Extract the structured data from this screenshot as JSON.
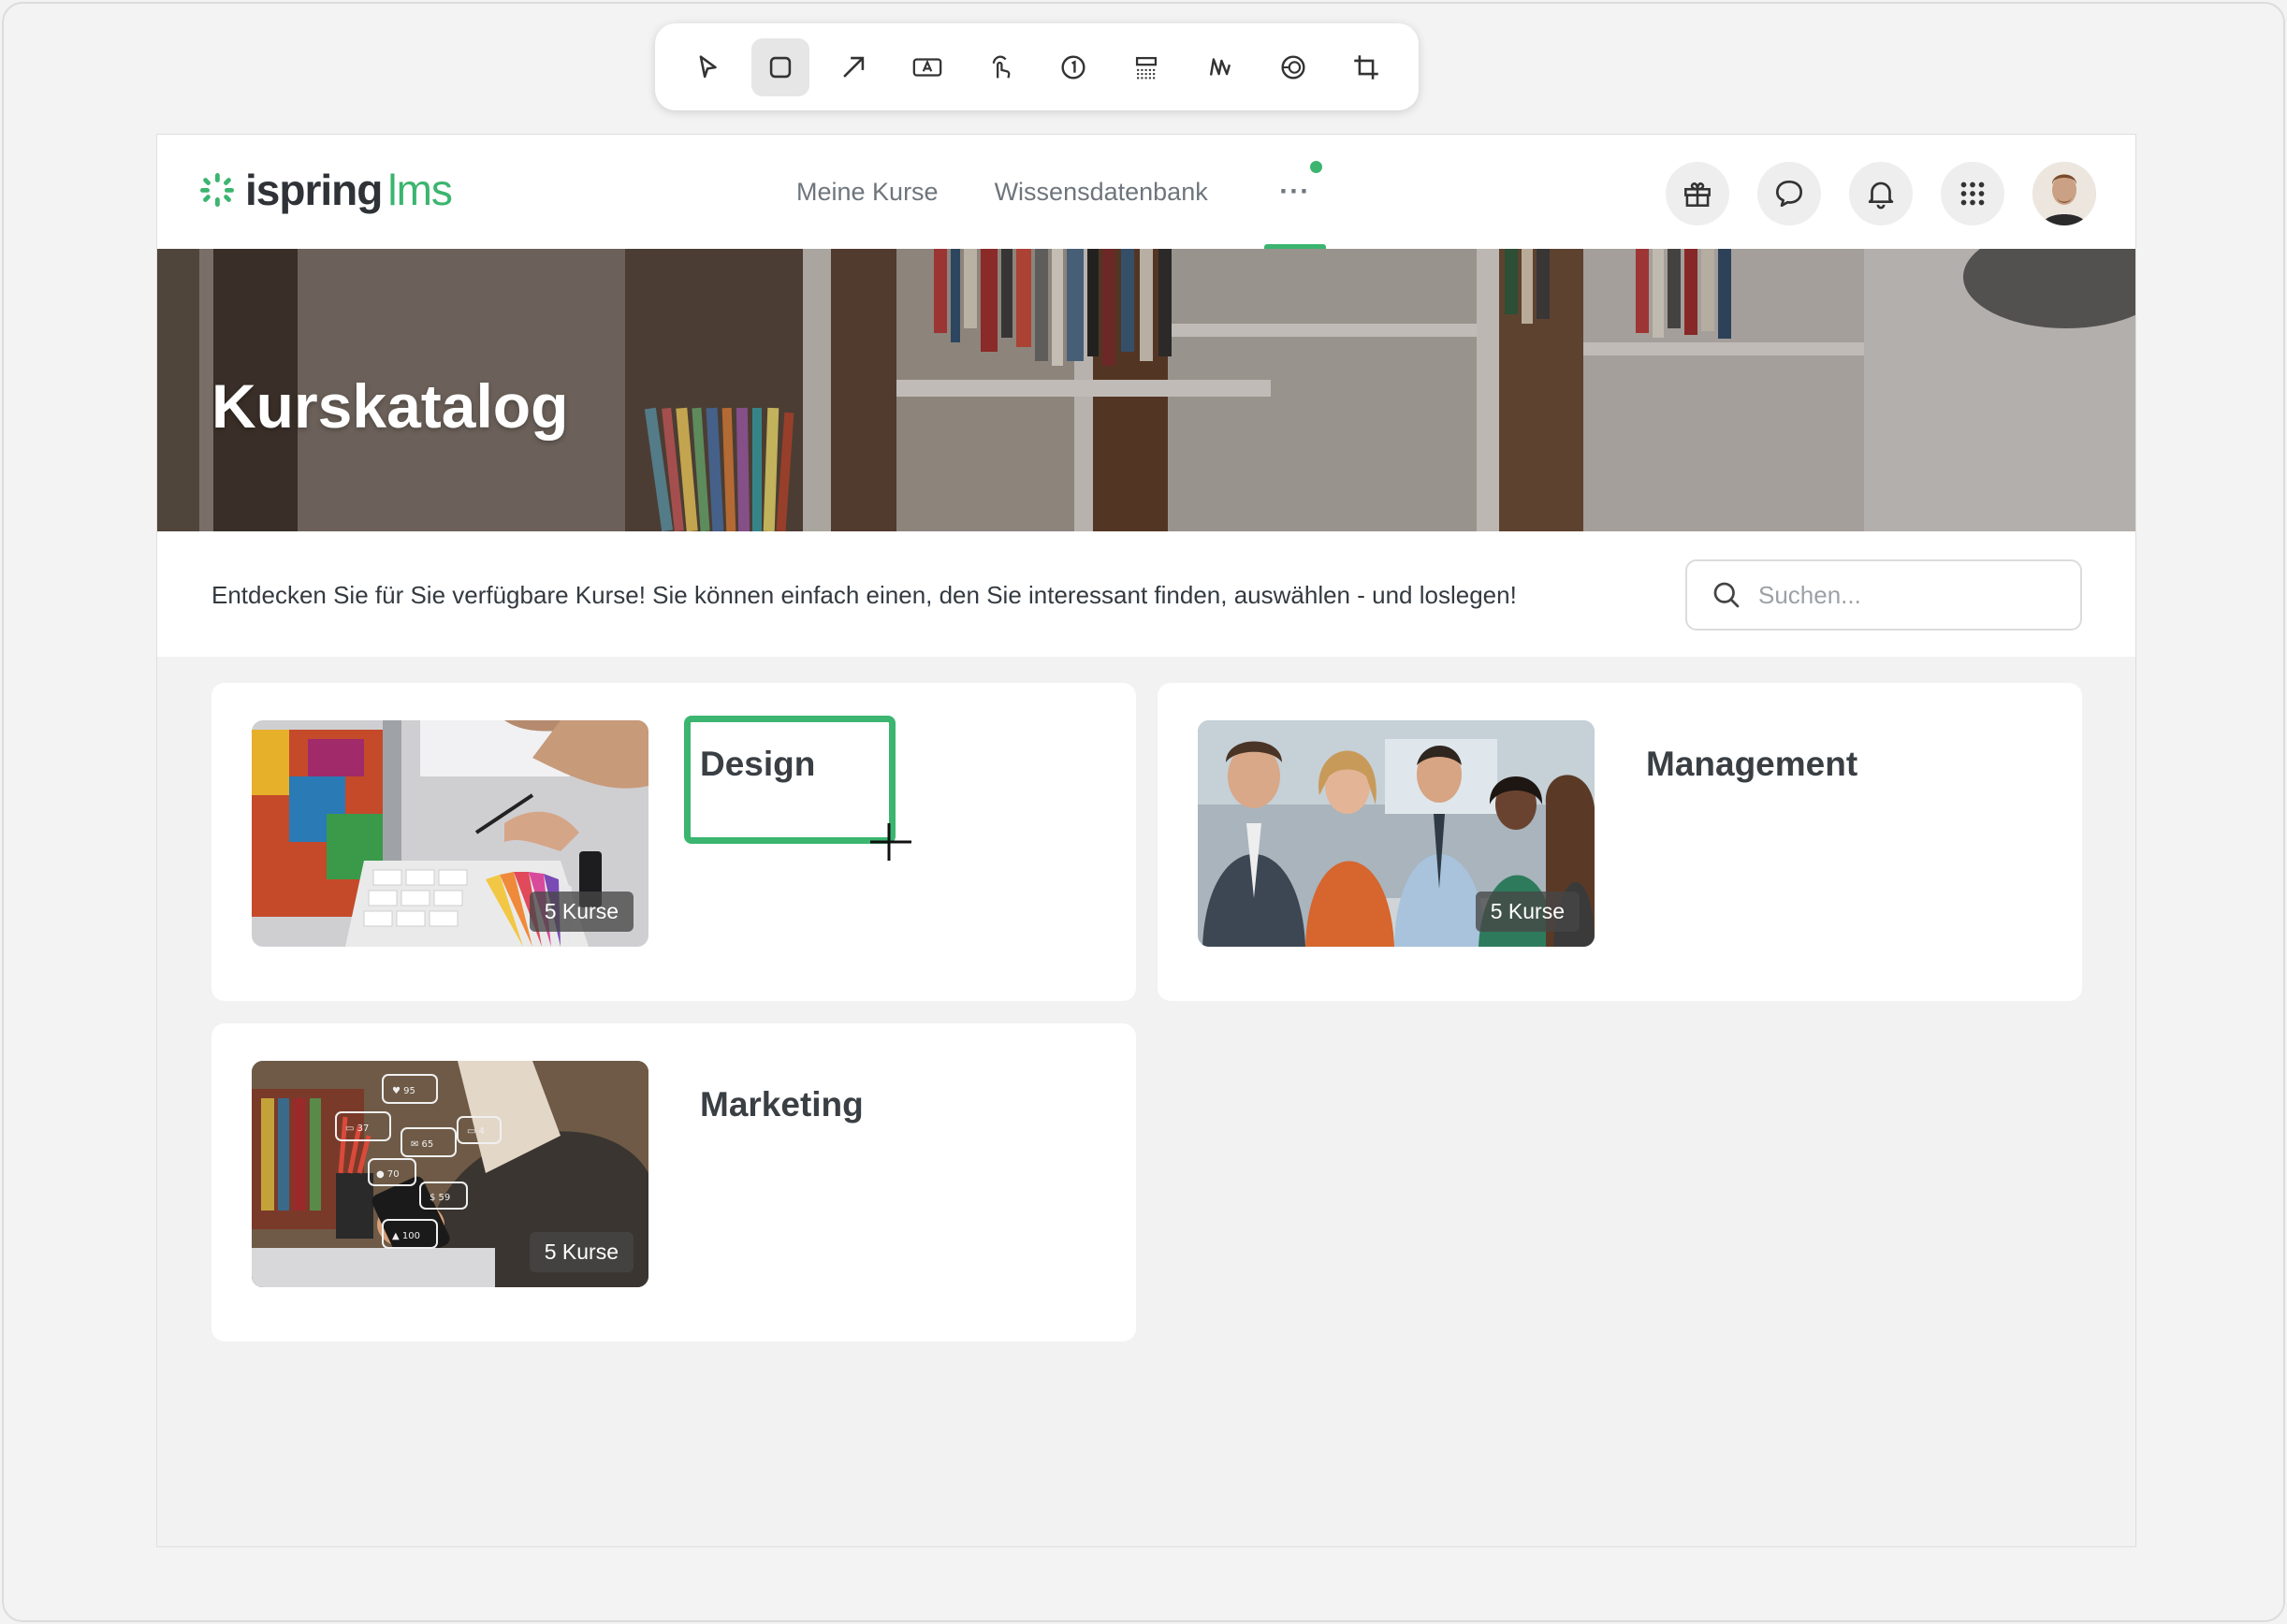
{
  "toolbar": {
    "tools": [
      "pointer-icon",
      "rectangle-icon",
      "arrow-icon",
      "text-icon",
      "click-icon",
      "number-icon",
      "blur-icon",
      "highlighter-icon",
      "spotlight-icon",
      "crop-icon"
    ],
    "active_tool": "rectangle-icon"
  },
  "header": {
    "logo_main": "ispring",
    "logo_suffix": "lms",
    "nav": [
      "Meine Kurse",
      "Wissensdatenbank"
    ],
    "more_label": "···"
  },
  "hero": {
    "title": "Kurskatalog"
  },
  "intro": {
    "text": "Entdecken Sie für Sie verfügbare Kurse! Sie können einfach einen, den Sie interessant finden, auswählen - und loslegen!",
    "search_placeholder": "Suchen..."
  },
  "catalog": {
    "items": [
      {
        "title": "Design",
        "count_label": "5 Kurse"
      },
      {
        "title": "Management",
        "count_label": "5 Kurse"
      },
      {
        "title": "Marketing",
        "count_label": "5 Kurse"
      }
    ]
  },
  "colors": {
    "accent": "#3bb56f",
    "text_dark": "#3a3f44",
    "nav_text": "#6e757c"
  }
}
